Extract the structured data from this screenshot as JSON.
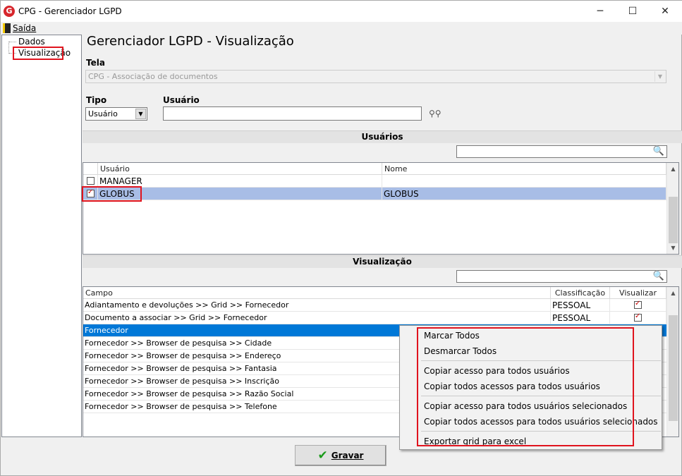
{
  "window": {
    "title": "CPG - Gerenciador LGPD",
    "app_icon": "G"
  },
  "menu": {
    "exit": "Saída"
  },
  "tree": {
    "items": [
      "Dados",
      "Visualização"
    ]
  },
  "main_title": "Gerenciador LGPD - Visualização",
  "tela": {
    "label": "Tela",
    "value": "CPG - Associação de documentos"
  },
  "tipo": {
    "label": "Tipo",
    "value": "Usuário"
  },
  "usuario": {
    "label": "Usuário",
    "value": ""
  },
  "users_section": {
    "title": "Usuários",
    "search_value": ""
  },
  "users_grid": {
    "columns": [
      "Usuário",
      "Nome"
    ],
    "rows": [
      {
        "checked": false,
        "usuario": "MANAGER",
        "nome": ""
      },
      {
        "checked": true,
        "usuario": "GLOBUS",
        "nome": "GLOBUS"
      }
    ]
  },
  "vis_section": {
    "title": "Visualização",
    "search_value": ""
  },
  "vis_grid": {
    "columns": [
      "Campo",
      "Classificação",
      "Visualizar"
    ],
    "rows": [
      {
        "campo": "Adiantamento e devoluções >> Grid >> Fornecedor",
        "classificacao": "PESSOAL",
        "visualizar": true
      },
      {
        "campo": "Documento a associar >> Grid >> Fornecedor",
        "classificacao": "PESSOAL",
        "visualizar": true
      },
      {
        "campo": "Fornecedor",
        "classificacao": "",
        "visualizar": false
      },
      {
        "campo": "Fornecedor >> Browser de pesquisa >> Cidade",
        "classificacao": "",
        "visualizar": false
      },
      {
        "campo": "Fornecedor >> Browser de pesquisa >> Endereço",
        "classificacao": "",
        "visualizar": false
      },
      {
        "campo": "Fornecedor >> Browser de pesquisa >> Fantasia",
        "classificacao": "",
        "visualizar": false
      },
      {
        "campo": "Fornecedor >> Browser de pesquisa >> Inscrição",
        "classificacao": "",
        "visualizar": false
      },
      {
        "campo": "Fornecedor >> Browser de pesquisa >> Razão Social",
        "classificacao": "",
        "visualizar": false
      },
      {
        "campo": "Fornecedor >> Browser de pesquisa >> Telefone",
        "classificacao": "",
        "visualizar": false
      }
    ]
  },
  "context_menu": {
    "items": [
      "Marcar Todos",
      "Desmarcar Todos",
      "Copiar acesso para todos usuários",
      "Copiar todos acessos para todos usuários",
      "Copiar acesso para todos usuários selecionados",
      "Copiar todos acessos para todos usuários selecionados",
      "Exportar grid para excel"
    ]
  },
  "save_button": {
    "label": "Gravar"
  },
  "colors": {
    "selected_row": "#a8bde6",
    "focused_row": "#0078d7",
    "highlight_box": "#e0141e",
    "accent_red": "#d7262c"
  },
  "icons": [
    "app-logo-icon",
    "exit-icon",
    "dropdown-arrow-icon",
    "binoculars-icon",
    "search-icon",
    "checkmark-icon"
  ]
}
